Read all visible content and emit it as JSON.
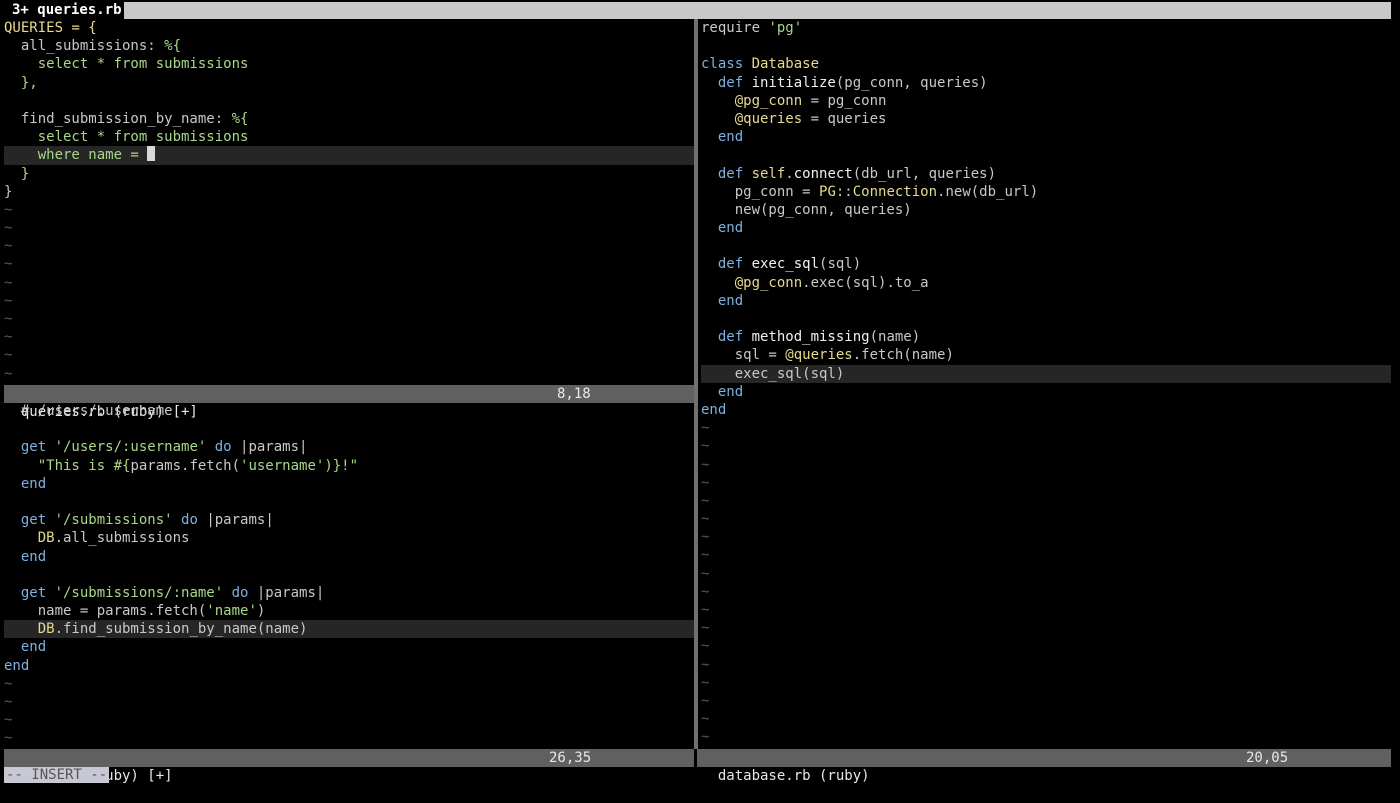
{
  "tabline": {
    "active_tab": "3+ queries.rb"
  },
  "editor": {
    "queries": {
      "status_name": "queries.rb (ruby) [+]",
      "status_pos": "8,18",
      "lines": [
        [
          {
            "t": "QUERIES = {",
            "c": "d"
          }
        ],
        [
          {
            "t": "  all_submissions: ",
            "c": "i"
          },
          {
            "t": "%{",
            "c": "s"
          }
        ],
        [
          {
            "t": "    select * from submissions",
            "c": "s"
          }
        ],
        [
          {
            "t": "  },",
            "c": "s"
          }
        ],
        [
          {
            "t": "",
            "c": "i"
          }
        ],
        [
          {
            "t": "  find_submission_by_name: ",
            "c": "i"
          },
          {
            "t": "%{",
            "c": "s"
          }
        ],
        [
          {
            "t": "    select * from submissions",
            "c": "s"
          }
        ],
        [
          {
            "t": "    where name = ",
            "c": "s"
          }
        ],
        [
          {
            "t": "  }",
            "c": "s"
          }
        ],
        [
          {
            "t": "}",
            "c": "i"
          }
        ]
      ],
      "cursor_line": 8,
      "tildes": 10
    },
    "main": {
      "status_name": "main.rb (ruby) [+]",
      "status_pos": "26,35",
      "lines": [
        [
          {
            "t": "  # /users/:username",
            "c": "i"
          }
        ],
        [
          {
            "t": "",
            "c": "i"
          }
        ],
        [
          {
            "t": "  get ",
            "c": "k"
          },
          {
            "t": "'/users/:username'",
            "c": "s"
          },
          {
            "t": " do ",
            "c": "k"
          },
          {
            "t": "|params|",
            "c": "i"
          }
        ],
        [
          {
            "t": "    \"This is #{",
            "c": "s"
          },
          {
            "t": "params.fetch(",
            "c": "i"
          },
          {
            "t": "'username'",
            "c": "s"
          },
          {
            "t": ")}!\"",
            "c": "s"
          }
        ],
        [
          {
            "t": "  end",
            "c": "k"
          }
        ],
        [
          {
            "t": "",
            "c": "i"
          }
        ],
        [
          {
            "t": "  get ",
            "c": "k"
          },
          {
            "t": "'/submissions'",
            "c": "s"
          },
          {
            "t": " do ",
            "c": "k"
          },
          {
            "t": "|params|",
            "c": "i"
          }
        ],
        [
          {
            "t": "    DB",
            "c": "d"
          },
          {
            "t": ".all_submissions",
            "c": "i"
          }
        ],
        [
          {
            "t": "  end",
            "c": "k"
          }
        ],
        [
          {
            "t": "",
            "c": "i"
          }
        ],
        [
          {
            "t": "  get ",
            "c": "k"
          },
          {
            "t": "'/submissions/:name'",
            "c": "s"
          },
          {
            "t": " do ",
            "c": "k"
          },
          {
            "t": "|params|",
            "c": "i"
          }
        ],
        [
          {
            "t": "    name = params.fetch(",
            "c": "i"
          },
          {
            "t": "'name'",
            "c": "s"
          },
          {
            "t": ")",
            "c": "i"
          }
        ],
        [
          {
            "t": "    DB",
            "c": "d"
          },
          {
            "t": ".find_submission_by_name(name)",
            "c": "i"
          }
        ],
        [
          {
            "t": "  end",
            "c": "k"
          }
        ],
        [
          {
            "t": "end",
            "c": "k"
          }
        ]
      ],
      "cursor_line": 13,
      "tildes": 4
    },
    "database": {
      "status_name": "database.rb (ruby)",
      "status_pos": "20,05",
      "lines": [
        [
          {
            "t": "require ",
            "c": "i"
          },
          {
            "t": "'pg'",
            "c": "s"
          }
        ],
        [
          {
            "t": "",
            "c": "i"
          }
        ],
        [
          {
            "t": "class ",
            "c": "k"
          },
          {
            "t": "Database",
            "c": "d"
          }
        ],
        [
          {
            "t": "  def ",
            "c": "k"
          },
          {
            "t": "initialize",
            "c": "f"
          },
          {
            "t": "(pg_conn, queries)",
            "c": "i"
          }
        ],
        [
          {
            "t": "    @pg_conn",
            "c": "d"
          },
          {
            "t": " = pg_conn",
            "c": "i"
          }
        ],
        [
          {
            "t": "    @queries",
            "c": "d"
          },
          {
            "t": " = queries",
            "c": "i"
          }
        ],
        [
          {
            "t": "  end",
            "c": "k"
          }
        ],
        [
          {
            "t": "",
            "c": "i"
          }
        ],
        [
          {
            "t": "  def ",
            "c": "k"
          },
          {
            "t": "self",
            "c": "d"
          },
          {
            "t": ".",
            "c": "i"
          },
          {
            "t": "connect",
            "c": "f"
          },
          {
            "t": "(db_url, queries)",
            "c": "i"
          }
        ],
        [
          {
            "t": "    pg_conn = ",
            "c": "i"
          },
          {
            "t": "PG",
            "c": "d"
          },
          {
            "t": "::",
            "c": "i"
          },
          {
            "t": "Connection",
            "c": "d"
          },
          {
            "t": ".new(db_url)",
            "c": "i"
          }
        ],
        [
          {
            "t": "    new(pg_conn, queries)",
            "c": "i"
          }
        ],
        [
          {
            "t": "  end",
            "c": "k"
          }
        ],
        [
          {
            "t": "",
            "c": "i"
          }
        ],
        [
          {
            "t": "  def ",
            "c": "k"
          },
          {
            "t": "exec_sql",
            "c": "f"
          },
          {
            "t": "(sql)",
            "c": "i"
          }
        ],
        [
          {
            "t": "    @pg_conn",
            "c": "d"
          },
          {
            "t": ".exec(sql).to_a",
            "c": "i"
          }
        ],
        [
          {
            "t": "  end",
            "c": "k"
          }
        ],
        [
          {
            "t": "",
            "c": "i"
          }
        ],
        [
          {
            "t": "  def ",
            "c": "k"
          },
          {
            "t": "method_missing",
            "c": "f"
          },
          {
            "t": "(name)",
            "c": "i"
          }
        ],
        [
          {
            "t": "    sql = ",
            "c": "i"
          },
          {
            "t": "@queries",
            "c": "d"
          },
          {
            "t": ".fetch(name)",
            "c": "i"
          }
        ],
        [
          {
            "t": "    exec_sql(sql)",
            "c": "i"
          }
        ],
        [
          {
            "t": "  end",
            "c": "k"
          }
        ],
        [
          {
            "t": "end",
            "c": "k"
          }
        ]
      ],
      "cursor_line": 20,
      "tildes": 18
    }
  },
  "cmdline": {
    "mode": "-- INSERT --"
  }
}
